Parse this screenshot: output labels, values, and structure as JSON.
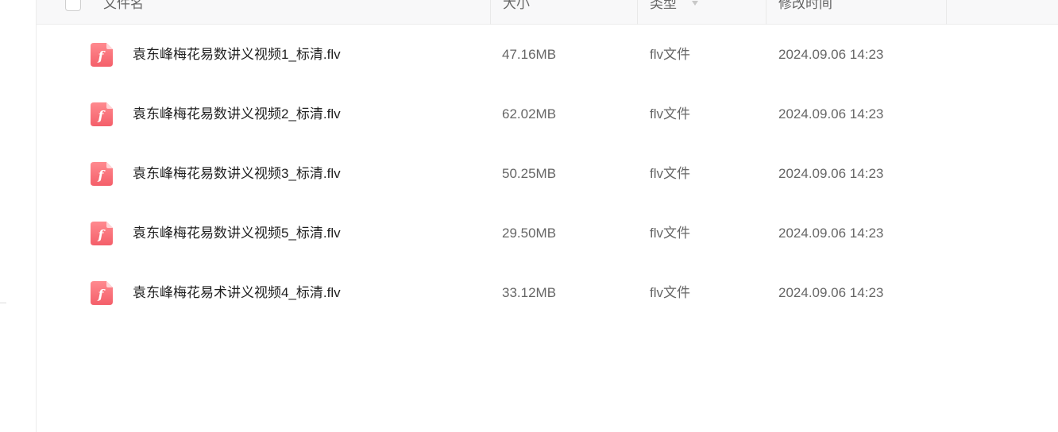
{
  "header": {
    "name_label": "文件名",
    "size_label": "大小",
    "type_label": "类型",
    "time_label": "修改时间"
  },
  "files": [
    {
      "icon": "flash-file-icon",
      "name": "袁东峰梅花易数讲义视频1_标清.flv",
      "size": "47.16MB",
      "type": "flv文件",
      "modified": "2024.09.06 14:23"
    },
    {
      "icon": "flash-file-icon",
      "name": "袁东峰梅花易数讲义视频2_标清.flv",
      "size": "62.02MB",
      "type": "flv文件",
      "modified": "2024.09.06 14:23"
    },
    {
      "icon": "flash-file-icon",
      "name": "袁东峰梅花易数讲义视频3_标清.flv",
      "size": "50.25MB",
      "type": "flv文件",
      "modified": "2024.09.06 14:23"
    },
    {
      "icon": "flash-file-icon",
      "name": "袁东峰梅花易数讲义视频5_标清.flv",
      "size": "29.50MB",
      "type": "flv文件",
      "modified": "2024.09.06 14:23"
    },
    {
      "icon": "flash-file-icon",
      "name": "袁东峰梅花易术讲义视频4_标清.flv",
      "size": "33.12MB",
      "type": "flv文件",
      "modified": "2024.09.06 14:23"
    }
  ],
  "colors": {
    "icon_top": "#ff8a8f",
    "icon_bottom": "#f45f6a"
  }
}
